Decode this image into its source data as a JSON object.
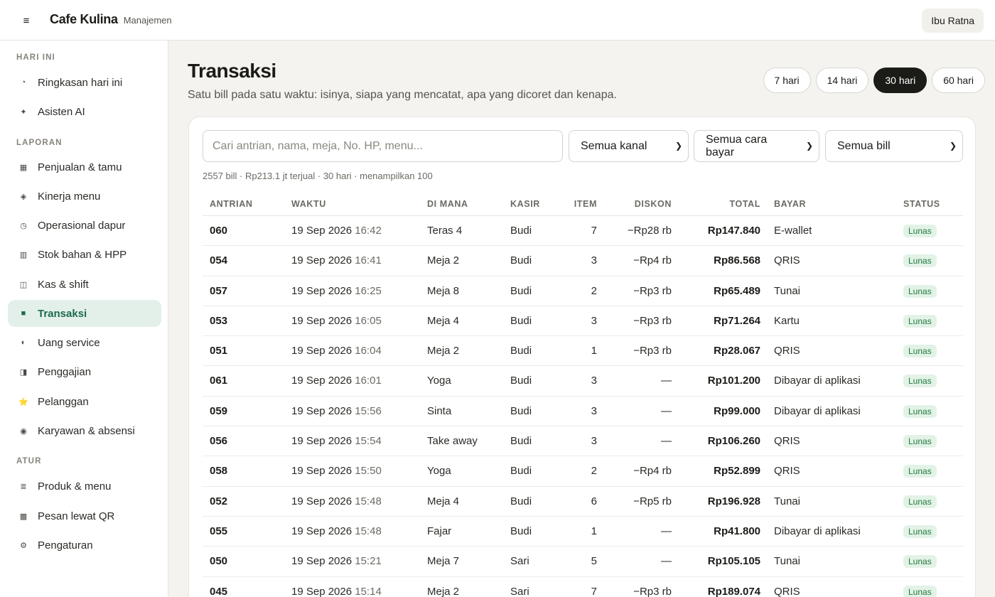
{
  "header": {
    "brand": "Cafe Kulina",
    "sub": "Manajemen",
    "user": "Ibu Ratna"
  },
  "sidebar": {
    "sections": [
      {
        "title": "HARI INI",
        "items": [
          {
            "label": "Ringkasan hari ini",
            "icon": "pie-clock-icon",
            "glyph": "◔"
          },
          {
            "label": "Asisten AI",
            "icon": "sparkle-icon",
            "glyph": "✦"
          }
        ]
      },
      {
        "title": "LAPORAN",
        "items": [
          {
            "label": "Penjualan & tamu",
            "icon": "chart-icon",
            "glyph": "▦"
          },
          {
            "label": "Kinerja menu",
            "icon": "diamond-icon",
            "glyph": "◈"
          },
          {
            "label": "Operasional dapur",
            "icon": "clock-icon",
            "glyph": "◷"
          },
          {
            "label": "Stok bahan & HPP",
            "icon": "grid-icon",
            "glyph": "▥"
          },
          {
            "label": "Kas & shift",
            "icon": "cashbox-icon",
            "glyph": "◫"
          },
          {
            "label": "Transaksi",
            "icon": "list-icon",
            "glyph": "■",
            "active": true
          },
          {
            "label": "Uang service",
            "icon": "half-circle-icon",
            "glyph": "◐"
          },
          {
            "label": "Penggajian",
            "icon": "wallet-icon",
            "glyph": "◨"
          },
          {
            "label": "Pelanggan",
            "icon": "star-icon",
            "glyph": "⭐"
          },
          {
            "label": "Karyawan & absensi",
            "icon": "target-icon",
            "glyph": "◉"
          }
        ]
      },
      {
        "title": "ATUR",
        "items": [
          {
            "label": "Produk & menu",
            "icon": "menu-icon",
            "glyph": "≣"
          },
          {
            "label": "Pesan lewat QR",
            "icon": "qr-icon",
            "glyph": "▩"
          },
          {
            "label": "Pengaturan",
            "icon": "gear-icon",
            "glyph": "⚙"
          }
        ]
      }
    ]
  },
  "main": {
    "title": "Transaksi",
    "subtitle": "Satu bill pada satu waktu: isinya, siapa yang mencatat, apa yang dicoret dan kenapa.",
    "ranges": [
      {
        "label": "7 hari",
        "active": false
      },
      {
        "label": "14 hari",
        "active": false
      },
      {
        "label": "30 hari",
        "active": true
      },
      {
        "label": "60 hari",
        "active": false
      }
    ],
    "search_placeholder": "Cari antrian, nama, meja, No. HP, menu...",
    "filters": {
      "channel": "Semua kanal",
      "payment": "Semua cara bayar",
      "bill": "Semua bill"
    },
    "summary": "2557 bill · Rp213.1 jt terjual · 30 hari · menampilkan 100",
    "columns": [
      "ANTRIAN",
      "WAKTU",
      "DI MANA",
      "KASIR",
      "ITEM",
      "DISKON",
      "TOTAL",
      "BAYAR",
      "STATUS"
    ],
    "rows": [
      {
        "q": "060",
        "date": "19 Sep 2026",
        "time": "16:42",
        "where": "Teras 4",
        "cashier": "Budi",
        "items": "7",
        "disc": "−Rp28 rb",
        "total": "Rp147.840",
        "pay": "E-wallet",
        "status": "Lunas"
      },
      {
        "q": "054",
        "date": "19 Sep 2026",
        "time": "16:41",
        "where": "Meja 2",
        "cashier": "Budi",
        "items": "3",
        "disc": "−Rp4 rb",
        "total": "Rp86.568",
        "pay": "QRIS",
        "status": "Lunas"
      },
      {
        "q": "057",
        "date": "19 Sep 2026",
        "time": "16:25",
        "where": "Meja 8",
        "cashier": "Budi",
        "items": "2",
        "disc": "−Rp3 rb",
        "total": "Rp65.489",
        "pay": "Tunai",
        "status": "Lunas"
      },
      {
        "q": "053",
        "date": "19 Sep 2026",
        "time": "16:05",
        "where": "Meja 4",
        "cashier": "Budi",
        "items": "3",
        "disc": "−Rp3 rb",
        "total": "Rp71.264",
        "pay": "Kartu",
        "status": "Lunas"
      },
      {
        "q": "051",
        "date": "19 Sep 2026",
        "time": "16:04",
        "where": "Meja 2",
        "cashier": "Budi",
        "items": "1",
        "disc": "−Rp3 rb",
        "total": "Rp28.067",
        "pay": "QRIS",
        "status": "Lunas"
      },
      {
        "q": "061",
        "date": "19 Sep 2026",
        "time": "16:01",
        "where": "Yoga",
        "cashier": "Budi",
        "items": "3",
        "disc": "—",
        "total": "Rp101.200",
        "pay": "Dibayar di aplikasi",
        "status": "Lunas"
      },
      {
        "q": "059",
        "date": "19 Sep 2026",
        "time": "15:56",
        "where": "Sinta",
        "cashier": "Budi",
        "items": "3",
        "disc": "—",
        "total": "Rp99.000",
        "pay": "Dibayar di aplikasi",
        "status": "Lunas"
      },
      {
        "q": "056",
        "date": "19 Sep 2026",
        "time": "15:54",
        "where": "Take away",
        "cashier": "Budi",
        "items": "3",
        "disc": "—",
        "total": "Rp106.260",
        "pay": "QRIS",
        "status": "Lunas"
      },
      {
        "q": "058",
        "date": "19 Sep 2026",
        "time": "15:50",
        "where": "Yoga",
        "cashier": "Budi",
        "items": "2",
        "disc": "−Rp4 rb",
        "total": "Rp52.899",
        "pay": "QRIS",
        "status": "Lunas"
      },
      {
        "q": "052",
        "date": "19 Sep 2026",
        "time": "15:48",
        "where": "Meja 4",
        "cashier": "Budi",
        "items": "6",
        "disc": "−Rp5 rb",
        "total": "Rp196.928",
        "pay": "Tunai",
        "status": "Lunas"
      },
      {
        "q": "055",
        "date": "19 Sep 2026",
        "time": "15:48",
        "where": "Fajar",
        "cashier": "Budi",
        "items": "1",
        "disc": "—",
        "total": "Rp41.800",
        "pay": "Dibayar di aplikasi",
        "status": "Lunas"
      },
      {
        "q": "050",
        "date": "19 Sep 2026",
        "time": "15:21",
        "where": "Meja 7",
        "cashier": "Sari",
        "items": "5",
        "disc": "—",
        "total": "Rp105.105",
        "pay": "Tunai",
        "status": "Lunas"
      },
      {
        "q": "045",
        "date": "19 Sep 2026",
        "time": "15:14",
        "where": "Meja 2",
        "cashier": "Sari",
        "items": "7",
        "disc": "−Rp3 rb",
        "total": "Rp189.074",
        "pay": "QRIS",
        "status": "Lunas"
      }
    ]
  }
}
